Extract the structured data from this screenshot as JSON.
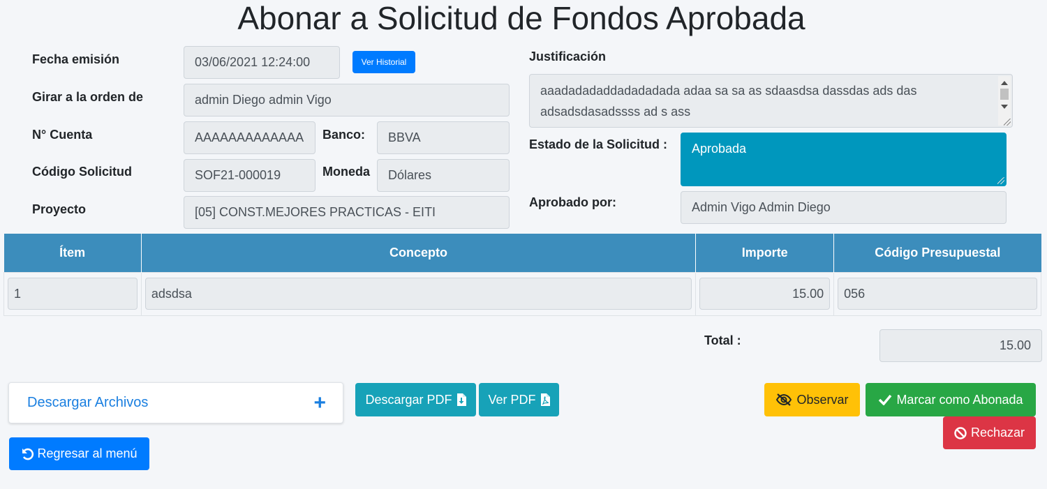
{
  "page": {
    "title": "Abonar a Solicitud de Fondos Aprobada"
  },
  "header": {
    "fecha_emision_label": "Fecha emisión",
    "fecha_emision_value": "03/06/2021 12:24:00",
    "ver_historial_label": "Ver Historial",
    "girar_label": "Girar a la orden de",
    "girar_value": "admin Diego admin Vigo",
    "cuenta_label": "N° Cuenta",
    "cuenta_value": "AAAAAAAAAAAAA",
    "banco_label": "Banco:",
    "banco_value": "BBVA",
    "codigo_label": "Código Solicitud",
    "codigo_value": "SOF21-000019",
    "moneda_label": "Moneda",
    "moneda_value": "Dólares",
    "proyecto_label": "Proyecto",
    "proyecto_value": "[05] CONST.MEJORES PRACTICAS - EITI",
    "justificacion_label": "Justificación",
    "justificacion_value": "aaadadadaddadadadada adaa sa sa as sdaasdsa dassdas ads das adsadsdasadssss ad s ass",
    "estado_label": "Estado de la Solicitud :",
    "estado_value": "Aprobada",
    "aprobado_label": "Aprobado por:",
    "aprobado_value": "Admin Vigo Admin Diego"
  },
  "table": {
    "columns": [
      "Ítem",
      "Concepto",
      "Importe",
      "Código Presupuestal"
    ],
    "rows": [
      {
        "item": "1",
        "concepto": "adsdsa",
        "importe": "15.00",
        "codigo": "056"
      }
    ]
  },
  "totals": {
    "label": "Total :",
    "value": "15.00"
  },
  "actions": {
    "descargar_archivos": "Descargar Archivos",
    "descargar_pdf": "Descargar PDF",
    "ver_pdf": "Ver PDF",
    "observar": "Observar",
    "marcar_abonada": "Marcar como Abonada",
    "rechazar": "Rechazar",
    "regresar": "Regresar al menú"
  },
  "colors": {
    "primary": "#007bff",
    "info": "#17a2b8",
    "warning": "#ffc107",
    "success": "#28a745",
    "danger": "#dc3545",
    "table_header": "#3c8dbc",
    "estado_bg": "#0097bd"
  },
  "icons": {
    "pdf_download": "file-download-icon",
    "pdf_view": "file-pdf-icon",
    "observar": "eye-slash-icon",
    "marcar": "check-icon",
    "rechazar": "ban-icon",
    "regresar": "undo-icon",
    "accordion": "plus-icon"
  }
}
